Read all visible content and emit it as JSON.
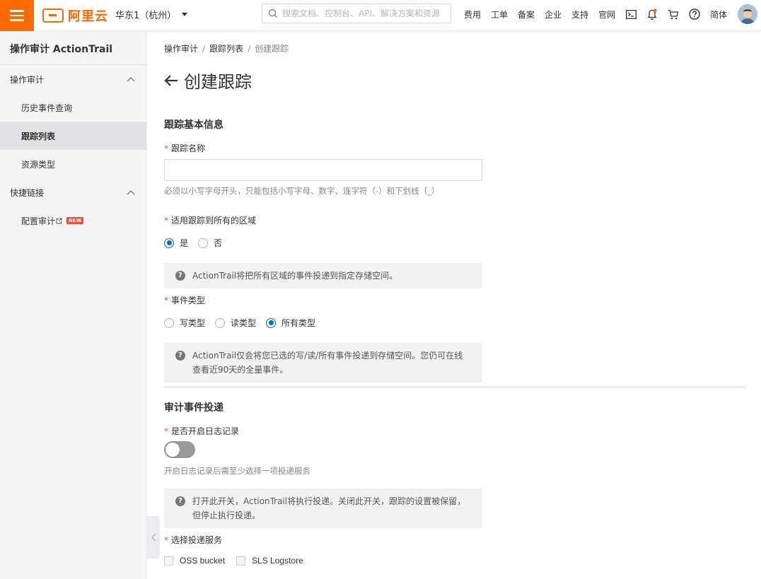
{
  "topbar": {
    "logo_text": "阿里云",
    "region": "华东1（杭州）",
    "search_placeholder": "搜索文档、控制台、API、解决方案和资源",
    "nav": [
      "费用",
      "工单",
      "备案",
      "企业",
      "支持",
      "官网"
    ],
    "language": "简体",
    "icons": [
      "terminal-icon",
      "bell-icon",
      "cart-icon",
      "help-icon"
    ]
  },
  "sidebar": {
    "title": "操作审计 ActionTrail",
    "groups": [
      {
        "label": "操作审计",
        "items": [
          "历史事件查询",
          "跟踪列表",
          "资源类型"
        ]
      },
      {
        "label": "快捷链接",
        "items": [
          "配置审计"
        ]
      }
    ],
    "active_item": "跟踪列表",
    "new_badge": "NEW"
  },
  "breadcrumb": [
    "操作审计",
    "跟踪列表",
    "创建跟踪"
  ],
  "page_title": "创建跟踪",
  "form": {
    "basic_section": "跟踪基本信息",
    "name_label": "跟踪名称",
    "name_value": "",
    "name_help": "必须以小写字母开头，只能包括小写字母、数字、连字符（-）和下划线（_）",
    "all_regions_label": "适用跟踪到所有的区域",
    "all_regions_options": [
      "是",
      "否"
    ],
    "all_regions_selected": "是",
    "all_regions_notice": "ActionTrail将把所有区域的事件投递到指定存储空间。",
    "event_type_label": "事件类型",
    "event_type_options": [
      "写类型",
      "读类型",
      "所有类型"
    ],
    "event_type_selected": "所有类型",
    "event_type_notice": "ActionTrail仅会将您已选的写/读/所有事件投递到存储空间。您仍可在线查看近90天的全量事件。",
    "delivery_section": "审计事件投递",
    "logging_label": "是否开启日志记录",
    "logging_enabled": false,
    "logging_help": "开启日志记录后需至少选择一项投递服务",
    "logging_notice": "打开此开关，ActionTrail将执行投递。关闭此开关，跟踪的设置被保留，但停止执行投递。",
    "service_label": "选择投递服务",
    "services": [
      "OSS bucket",
      "SLS Logstore"
    ]
  },
  "colors": {
    "brand": "#ff6a00",
    "primary": "#0070cc",
    "required": "#f04134"
  }
}
